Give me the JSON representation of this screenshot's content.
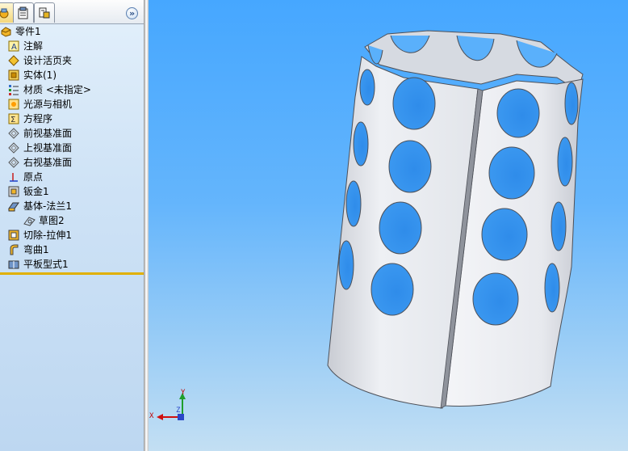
{
  "feature_tree": {
    "items": [
      {
        "label": "零件1",
        "icon": "part-icon",
        "indent": 0
      },
      {
        "label": "注解",
        "icon": "annotations-icon",
        "indent": 1
      },
      {
        "label": "设计活页夹",
        "icon": "design-binder-icon",
        "indent": 1
      },
      {
        "label": "实体(1)",
        "icon": "solid-bodies-icon",
        "indent": 1
      },
      {
        "label": "材质 <未指定>",
        "icon": "material-icon",
        "indent": 1
      },
      {
        "label": "光源与相机",
        "icon": "lights-cameras-icon",
        "indent": 1
      },
      {
        "label": "方程序",
        "icon": "equations-icon",
        "indent": 1
      },
      {
        "label": "前视基准面",
        "icon": "plane-icon",
        "indent": 1
      },
      {
        "label": "上视基准面",
        "icon": "plane-icon",
        "indent": 1
      },
      {
        "label": "右视基准面",
        "icon": "plane-icon",
        "indent": 1
      },
      {
        "label": "原点",
        "icon": "origin-icon",
        "indent": 1
      },
      {
        "label": "钣金1",
        "icon": "sheet-metal-icon",
        "indent": 1
      },
      {
        "label": "基体-法兰1",
        "icon": "base-flange-icon",
        "indent": 1
      },
      {
        "label": "草图2",
        "icon": "sketch-icon",
        "indent": 2
      },
      {
        "label": "切除-拉伸1",
        "icon": "cut-extrude-icon",
        "indent": 1
      },
      {
        "label": "弯曲1",
        "icon": "bend-icon",
        "indent": 1
      },
      {
        "label": "平板型式1",
        "icon": "flat-pattern-icon",
        "indent": 1
      }
    ]
  },
  "panel": {
    "collapse_label": "»"
  },
  "triad": {
    "x": "X",
    "y": "Y",
    "z": "Z"
  },
  "colors": {
    "viewport_top": "#46a7ff",
    "viewport_bottom": "#c3dff3",
    "panel_bg": "#cfe3f6",
    "model_face": "#e6e9ee"
  }
}
